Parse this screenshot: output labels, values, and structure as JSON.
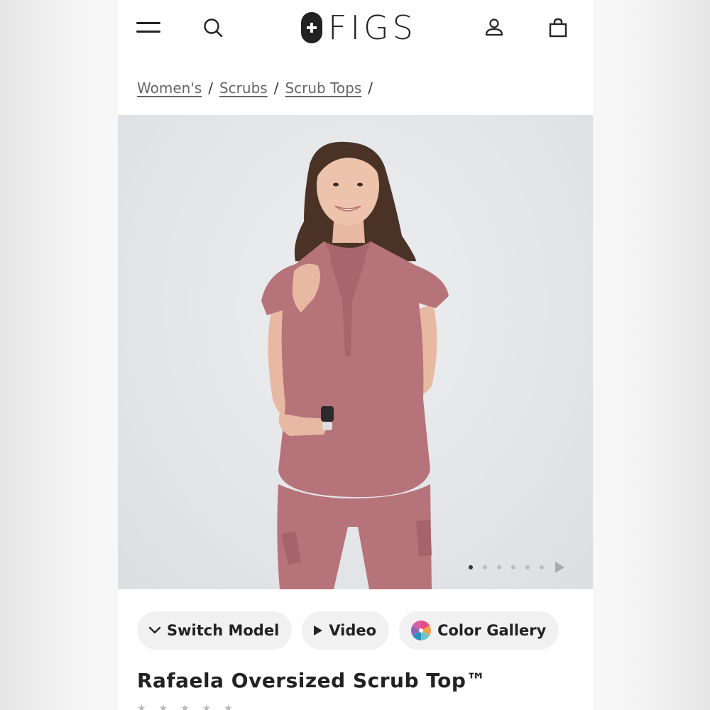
{
  "brand": {
    "logo_text": "FIGS"
  },
  "header": {
    "menu_icon": "hamburger-menu-icon",
    "search_icon": "search-icon",
    "account_icon": "user-account-icon",
    "bag_icon": "shopping-bag-icon"
  },
  "breadcrumb": {
    "items": [
      {
        "label": "Women's"
      },
      {
        "label": "Scrubs"
      },
      {
        "label": "Scrub Tops"
      }
    ],
    "separator": "/"
  },
  "gallery": {
    "image_description_icon": "product-photo",
    "total_images": 6,
    "active_index": 0,
    "next_icon": "play-right-icon"
  },
  "actions": {
    "switch_model": {
      "label": "Switch Model",
      "icon": "chevron-down-icon"
    },
    "video": {
      "label": "Video",
      "icon": "play-icon"
    },
    "color_gallery": {
      "label": "Color Gallery",
      "icon": "color-wheel-icon"
    }
  },
  "product": {
    "title": "Rafaela Oversized Scrub Top™"
  },
  "colors": {
    "scrub": "#b7737a",
    "background": "#e4e6e9",
    "text": "#222222"
  }
}
